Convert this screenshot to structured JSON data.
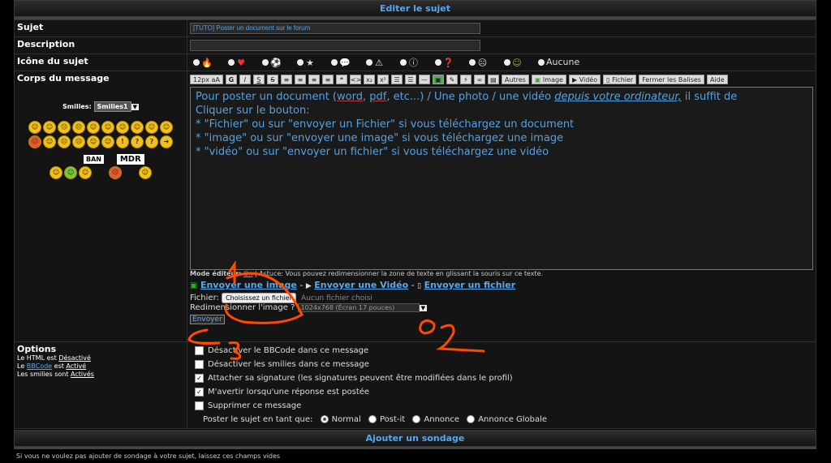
{
  "header": {
    "title": "Editer le sujet"
  },
  "fields": {
    "sujet_label": "Sujet",
    "sujet_value": "[TUTO] Poster un document sur le forum",
    "description_label": "Description",
    "description_value": "",
    "icone_label": "Icône du sujet",
    "icone_none": "Aucune",
    "corps_label": "Corps du message"
  },
  "smilies": {
    "label": "Smilies:",
    "select": "Smilies1",
    "ban": "BAN",
    "mdr": "MDR"
  },
  "toolbar": {
    "size": "12px",
    "autres": "Autres",
    "image": "Image",
    "video": "Vidéo",
    "fichier": "Fichier",
    "fermer": "Fermer les Balises",
    "aide": "Aide"
  },
  "message": {
    "line1a": "Pour poster un document (",
    "word": "word",
    "sep1": ", ",
    "pdf": "pdf",
    "line1b": ", etc...) / Une photo / une vidéo ",
    "depuis": "depuis votre ordinateur,",
    "line1c": " il suffit de",
    "line2": "Cliquer sur le bouton:",
    "line3": "* \"Fichier\" ou sur \"envoyer un Fichier\" si vous téléchargez un document",
    "line4": "* \"image\" ou sur \"envoyer une image\" si vous téléchargez une image",
    "line5": "* \"vidéo\" ou sur \"envoyer un fichier\" si vous téléchargez une vidéo"
  },
  "editor": {
    "mode_label": "Mode éditeur:",
    "mode_on": "On",
    "astuce": " | Astuce: Vous pouvez redimensionner la zone de texte en glissant la souris sur ce texte.",
    "envoyer_image": "Envoyer une image",
    "envoyer_video": "Envoyer une Vidéo",
    "envoyer_fichier": "Envoyer un fichier",
    "fichier_label": "Fichier:",
    "choose_file": "Choisissez un fichier",
    "no_file": "Aucun fichier choisi",
    "resize_label": "Redimensionner l'image ?",
    "resize_value": "1024x768 (Écran 17 pouces)",
    "send": "Envoyer"
  },
  "options": {
    "title": "Options",
    "html_text": "Le HTML est ",
    "html_state": "Désactivé",
    "bbcode_pre": "Le ",
    "bbcode_word": "BBCode",
    "bbcode_mid": " est ",
    "bbcode_state": "Activé",
    "smilies_text": "Les smilies sont ",
    "smilies_state": "Activés",
    "items": [
      {
        "label": "Désactiver le BBCode dans ce message",
        "checked": false
      },
      {
        "label": "Désactiver les smilies dans ce message",
        "checked": false
      },
      {
        "label": "Attacher sa signature (les signatures peuvent être modifiées dans le profil)",
        "checked": true
      },
      {
        "label": "M'avertir lorsqu'une réponse est postée",
        "checked": true
      },
      {
        "label": "Supprimer ce message",
        "checked": false
      }
    ],
    "post_as": "Poster le sujet en tant que:",
    "types": [
      "Normal",
      "Post-it",
      "Annonce",
      "Annonce Globale"
    ],
    "selected_type": "Normal"
  },
  "poll": {
    "title": "Ajouter un sondage",
    "hint": "Si vous ne voulez pas ajouter de sondage à votre sujet, laissez ces champs vides"
  },
  "annotations": {
    "n1": "1",
    "n2": "2",
    "n3": "3"
  },
  "colors": {
    "accent": "#57a8f0",
    "annotation": "#ff4a00"
  }
}
